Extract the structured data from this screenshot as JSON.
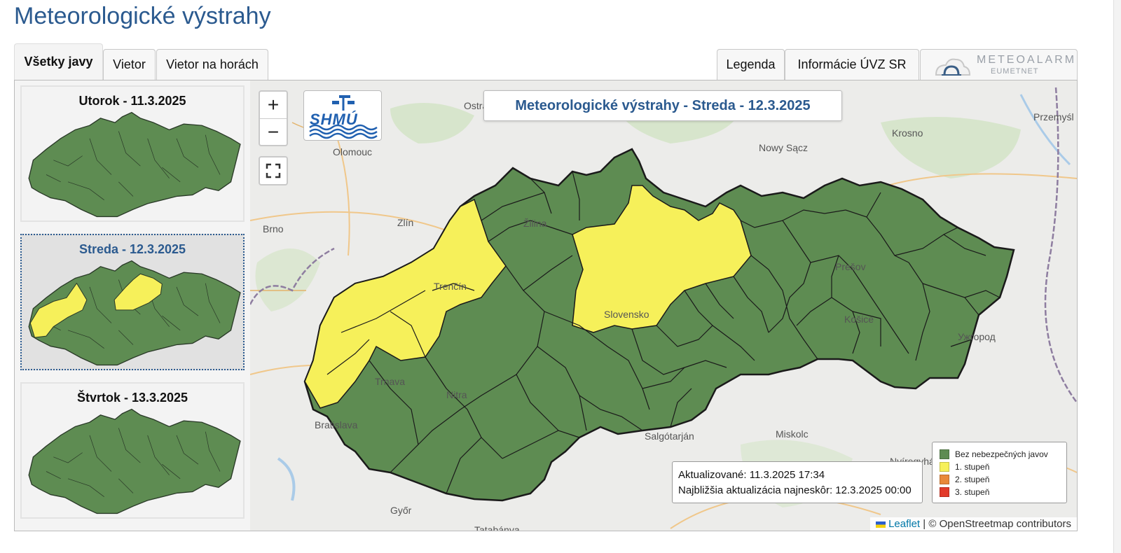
{
  "page": {
    "title": "Meteorologické výstrahy"
  },
  "tabs": {
    "left": [
      {
        "label": "Všetky javy",
        "active": true
      },
      {
        "label": "Vietor",
        "active": false
      },
      {
        "label": "Vietor na horách",
        "active": false
      }
    ],
    "right": [
      {
        "label": "Legenda"
      },
      {
        "label": "Informácie ÚVZ SR"
      }
    ],
    "meteoalarm": {
      "brand": "METEOALARM",
      "sub": "EUMETNET"
    }
  },
  "days": [
    {
      "label": "Utorok - 11.3.2025",
      "active": false,
      "warning_regions": "none"
    },
    {
      "label": "Streda - 12.3.2025",
      "active": true,
      "warning_regions": "west-and-central"
    },
    {
      "label": "Štvrtok - 13.3.2025",
      "active": false,
      "warning_regions": "none"
    }
  ],
  "map": {
    "title": "Meteorologické výstrahy - Streda - 12.3.2025",
    "logo_text": "SHMÚ",
    "zoom_in": "+",
    "zoom_out": "−",
    "fullscreen_icon": "fullscreen-icon",
    "updated": "Aktualizované: 11.3.2025 17:34",
    "next_update": "Najbližšia aktualizácia najneskôr: 12.3.2025 00:00",
    "legend": [
      {
        "label": "Bez nebezpečných javov",
        "color": "#5e8c52"
      },
      {
        "label": "1. stupeň",
        "color": "#f6f05a"
      },
      {
        "label": "2. stupeň",
        "color": "#e8893a"
      },
      {
        "label": "3. stupeň",
        "color": "#e23b2a"
      }
    ],
    "attribution_leaflet": "Leaflet",
    "attribution_rest": "| © OpenStreetmap contributors",
    "places": [
      "Ostrava",
      "Olomouc",
      "Brno",
      "Zlín",
      "Žilina",
      "Trenčín",
      "Slovensko",
      "Prešov",
      "Košice",
      "Ужгород",
      "Trnava",
      "Nitra",
      "Bratislava",
      "Nowy Sącz",
      "Krosno",
      "Przemyśl",
      "Salgótarján",
      "Miskolc",
      "Nyíregyháza",
      "Győr",
      "Tatabánya"
    ]
  },
  "colors": {
    "green": "#5e8c52",
    "yellow": "#f6f05a",
    "title_blue": "#2b5a8f"
  }
}
